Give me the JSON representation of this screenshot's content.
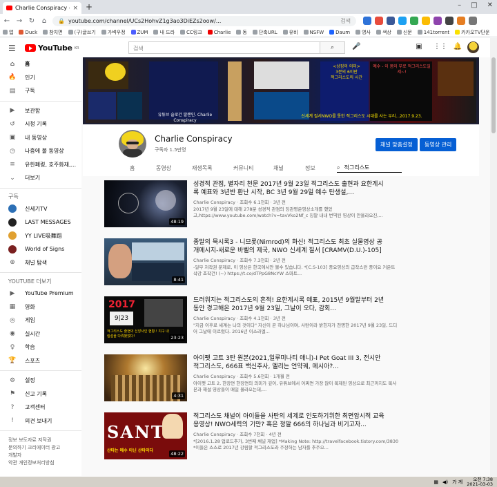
{
  "browser": {
    "tab_title": "Charlie Conspiracy - YouTube",
    "tab_close": "×",
    "new_tab": "+",
    "url": "youtube.com/channel/UCs2HohvZ1g3ao3DiEZs2oow/...",
    "url_search_hint": "검색",
    "bookmarks": [
      "앱",
      "Duck",
      "참치면",
      "(구)글쓰기",
      "가벼우정",
      "ZUM",
      "내 드라",
      "CC링크",
      "Charlie",
      "동",
      "단축URL",
      "유비",
      "NSFW",
      "Daum",
      "영사",
      "색상",
      "신문",
      "141torrent",
      "카카오TV단운"
    ]
  },
  "youtube": {
    "logo_text": "YouTube",
    "logo_cc": "KR",
    "search_placeholder": "검색"
  },
  "sidebar": {
    "main": [
      {
        "icon": "⌂",
        "label": "홈"
      },
      {
        "icon": "🔥",
        "label": "인기"
      },
      {
        "icon": "▤",
        "label": "구독"
      }
    ],
    "library": [
      {
        "icon": "▶",
        "label": "보관함"
      },
      {
        "icon": "↺",
        "label": "시청 기록"
      },
      {
        "icon": "▣",
        "label": "내 동영상"
      },
      {
        "icon": "◷",
        "label": "나중에 볼 동영상"
      },
      {
        "icon": "≡",
        "label": "유한폐령, 호주화재,..."
      },
      {
        "icon": "⌄",
        "label": "더보기"
      }
    ],
    "subs_header": "구독",
    "subs": [
      {
        "label": "신세기TV"
      },
      {
        "label": "LAST MESSAGES"
      },
      {
        "label": "YY LIVE吸舞蹈"
      },
      {
        "label": "World of Signs"
      },
      {
        "label": "채널 탐색"
      }
    ],
    "more_header": "YOUTUBE 더보기",
    "more": [
      {
        "icon": "▶",
        "label": "YouTube Premium"
      },
      {
        "icon": "▦",
        "label": "영화"
      },
      {
        "icon": "◎",
        "label": "게임"
      },
      {
        "icon": "◉",
        "label": "실시간"
      },
      {
        "icon": "♀",
        "label": "학습"
      },
      {
        "icon": "🏆",
        "label": "스포츠"
      }
    ],
    "settings": [
      {
        "icon": "⚙",
        "label": "설정"
      },
      {
        "icon": "⚑",
        "label": "신고 기록"
      },
      {
        "icon": "?",
        "label": "고객센터"
      },
      {
        "icon": "!",
        "label": "의견 보내기"
      }
    ],
    "footer1": "정보 보도자료 저작권",
    "footer2": "문의하기 크리에이터 광고",
    "footer3": "개발자",
    "footer4": "약관 개인정보처리방침"
  },
  "channel": {
    "name": "Charlie Conspiracy",
    "subscribers": "구독자 1.5만명",
    "customize_button": "채널 맞춤설정",
    "manage_button": "동영상 관리",
    "tabs": [
      "홈",
      "동영상",
      "재생목록",
      "커뮤니티",
      "채널",
      "정보"
    ],
    "tab_search": "적그리스도"
  },
  "banner": {
    "text_a": "<상징의 의미>",
    "text_b": "3분의 6이란",
    "text_c": "적그리스도의 시간",
    "text_d": "예수 - 이 몸이 부로 적그리스도일세~!",
    "text_e": "유튜브 슬로건 딸랜인. Charlie Conspiracy",
    "text_f": "신세계 질서NWO를 통한 적그리스도 시대를 사는 우리...2017.9.23."
  },
  "videos": [
    {
      "title": "성경적 관점, 별자리 천문 2017년 9월 23일 적그리스도 출현과 요한계시록 예표와 3년반 환난 시작, BC 3년 9월 29일 예수 탄생설,...",
      "channel": "Charlie Conspiracy",
      "stats": "조회수 6.1천회 · 3년 전",
      "desc": "2017년 9월 23일에 대해 278분 성경적 관점의 징관명운영상소개를 했었고,https://www.youtube.com/watch?v=tavVko2Nf_c 징말 내내 번역된 영상이 안을라오진,...",
      "duration": "48:19",
      "theme": "space"
    },
    {
      "title": "종말의 묵시록3 - 니므롯(Nimrod)의 화신! 적그리스도 최초 실물영상 공개메시지-새로운 바벨의 제국, NWO 신세계 질서 [CRAMV(D.U.)-105]",
      "channel": "Charlie Conspiracy",
      "stats": "조회수 7.3천회 · 2년 전",
      "desc": "-일부 저작권 문제로, 이 영상은 한국에서만 볼수 있습니다. *[C.S-103] 중요영상의 급작스런 중이요 커운트 삭강 조작건! (~) https://t.co/dTPpG8NcYW 스마트...",
      "duration": "8:41",
      "theme": "face"
    },
    {
      "title": "드러워지는 적그리스도의 흔적! 요한계시록 예표, 2015년 9월말부터 2년동안 경고해온 2017년 9월 23일, 그날이 오다, 감회...",
      "channel": "Charlie Conspiracy",
      "stats": "조회수 4.1천회 · 3년 전",
      "desc": "\"지금 이후로 세계는 나의 것이다\" 자신이 곧 하나님이며, 사탄이라 밝힌자가 천명한 2017년 9월 23일, 드디어 그날에 이르렀다. 2016년 이스라엘...",
      "duration": "23:23",
      "theme": "calendar",
      "thumb_top": "2017",
      "thumb_mid": "9|23",
      "thumb_cap": "적그리스도 출현의 신앙사인 현황.! 지구 내림설을 다뤄봤었다!"
    },
    {
      "title": "아이펫 고트 3탄 원본(2021,일루미나티 애니)-I Pet Goat III 3, 전시안 적그리스도, 666표 백신주사, 엘리는 언약궤, 메시아?...",
      "channel": "Charlie Conspiracy",
      "stats": "조회수 5.6천회 · 1개월 전",
      "desc": "아이펫 고트 2, 한장면 한장면의 의미가 깊어, 유튜브에서 어쩌면 가장 많이 복제된 영상으로 최근까지도 복사본과 해설 영상들이 매일 올라오는데,...",
      "duration": "4:31",
      "theme": "temple"
    },
    {
      "title": "적그리스도 채널이 아이들을 사탄의 세계로 인도하기위한 최면암시적 교육용영상! NWO세력의 기만? 혹은 정말 666의 하나님과 비기고자...",
      "channel": "Charlie Conspiracy",
      "stats": "조회수 7천회 · 4년 전",
      "desc": "*[2016.1.28 업로드추가, 3번째 채널 재업] *Making Note: http://travelfacebook.tistory.com/3830 *이들은 스스로 2017년 강림할 적그리스도라 주장하는 남자를 추주으...",
      "duration": "48:22",
      "theme": "santa",
      "thumb_big": "SANTA",
      "thumb_cap": "산타는 예수 아닌 산타이다"
    }
  ],
  "taskbar": {
    "ime": "가 계",
    "time": "오전 7:38",
    "date": "2021-03-03"
  },
  "colors": {
    "youtube_red": "#ff0000",
    "blue_button": "#065fd4",
    "sidebar_bg": "#ffffff",
    "page_bg": "#f9f9f9"
  }
}
